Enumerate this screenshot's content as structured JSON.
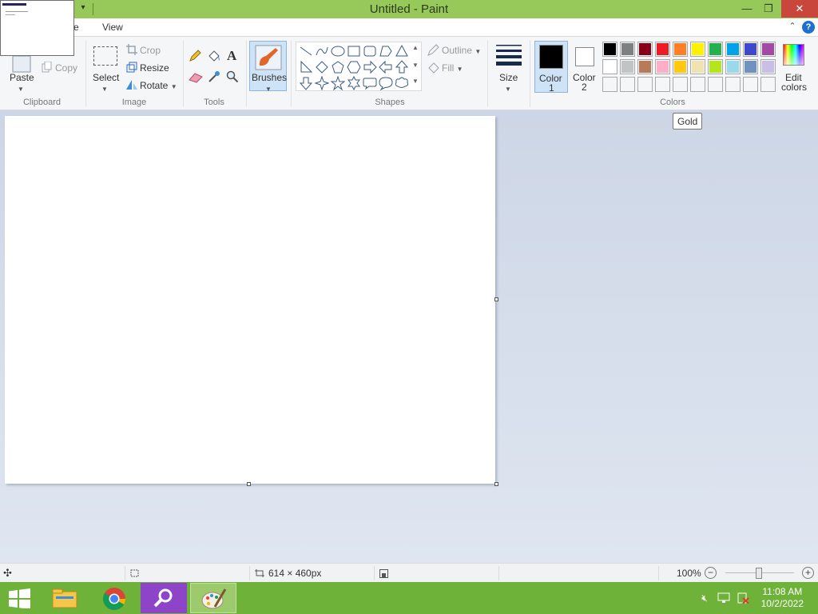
{
  "window": {
    "title": "Untitled - Paint"
  },
  "tabs": {
    "home": "e",
    "view": "View"
  },
  "ribbon": {
    "clipboard": {
      "label": "Clipboard",
      "paste": "Paste",
      "copy": "Copy"
    },
    "image": {
      "label": "Image",
      "select": "Select",
      "crop": "Crop",
      "resize": "Resize",
      "rotate": "Rotate"
    },
    "tools": {
      "label": "Tools"
    },
    "brushes": {
      "label": "Brushes"
    },
    "shapes": {
      "label": "Shapes",
      "outline": "Outline",
      "fill": "Fill"
    },
    "size": {
      "label": "Size"
    },
    "colors": {
      "label": "Colors",
      "color1": "Color",
      "color1_num": "1",
      "color2": "Color",
      "color2_num": "2",
      "edit": "Edit",
      "edit2": "colors",
      "row1": [
        "#000000",
        "#7f7f7f",
        "#880015",
        "#ed1c24",
        "#ff7f27",
        "#fff200",
        "#22b14c",
        "#00a2e8",
        "#3f48cc",
        "#a349a4"
      ],
      "row2": [
        "#ffffff",
        "#c3c3c3",
        "#b97a57",
        "#ffaec9",
        "#ffc90e",
        "#efe4b0",
        "#b5e61d",
        "#99d9ea",
        "#7092be",
        "#c8bfe7"
      ]
    }
  },
  "tooltip": "Gold",
  "status": {
    "dimensions": "614 × 460px",
    "zoom": "100%"
  },
  "taskbar": {
    "time": "11:08 AM",
    "date": "10/2/2022"
  }
}
